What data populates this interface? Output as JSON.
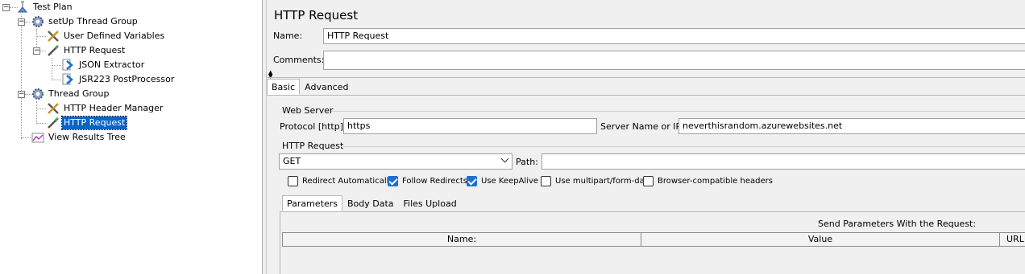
{
  "tree": {
    "items": [
      {
        "label": "Test Plan",
        "icon": "test-plan-icon"
      },
      {
        "label": "setUp Thread Group",
        "icon": "gear-icon"
      },
      {
        "label": "User Defined Variables",
        "icon": "wrench-icon"
      },
      {
        "label": "HTTP Request",
        "icon": "pipette-icon"
      },
      {
        "label": "JSON Extractor",
        "icon": "arrow-icon"
      },
      {
        "label": "JSR223 PostProcessor",
        "icon": "arrow-icon"
      },
      {
        "label": "Thread Group",
        "icon": "gear-icon"
      },
      {
        "label": "HTTP Header Manager",
        "icon": "wrench-icon"
      },
      {
        "label": "HTTP Request",
        "icon": "pipette-icon"
      },
      {
        "label": "View Results Tree",
        "icon": "graph-icon"
      }
    ],
    "selected_index": 8
  },
  "panel": {
    "title": "HTTP Request",
    "name_label": "Name:",
    "name_value": "HTTP Request",
    "comments_label": "Comments:",
    "comments_value": "",
    "tabs": [
      "Basic",
      "Advanced"
    ],
    "web_server": {
      "title": "Web Server",
      "protocol_label": "Protocol [http]:",
      "protocol_value": "https",
      "server_label": "Server Name or IP:",
      "server_value": "neverthisrandom.azurewebsites.net"
    },
    "http_request": {
      "title": "HTTP Request",
      "method": "GET",
      "path_label": "Path:",
      "path_value": ""
    },
    "checkboxes": [
      {
        "label": "Redirect Automatically",
        "checked": false
      },
      {
        "label": "Follow Redirects",
        "checked": true
      },
      {
        "label": "Use KeepAlive",
        "checked": true
      },
      {
        "label": "Use multipart/form-data",
        "checked": false
      },
      {
        "label": "Browser-compatible headers",
        "checked": false
      }
    ],
    "sub_tabs": [
      "Parameters",
      "Body Data",
      "Files Upload"
    ],
    "params_heading": "Send Parameters With the Request:",
    "columns": [
      "Name:",
      "Value",
      "URL E"
    ]
  },
  "colors": {
    "selection": "#0a64c8",
    "check_accent": "#1f6fd0"
  }
}
